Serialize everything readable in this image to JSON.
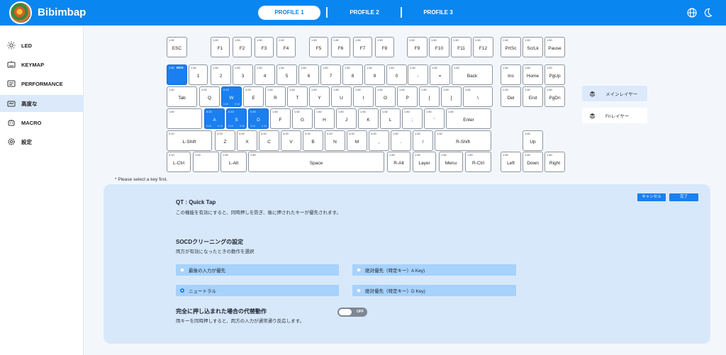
{
  "app": {
    "title": "Bibimbap"
  },
  "profiles": [
    {
      "label": "PROFILE 1",
      "active": true
    },
    {
      "label": "PROFILE 2",
      "active": false
    },
    {
      "label": "PROFILE 3",
      "active": false
    }
  ],
  "header_icons": [
    "globe-icon",
    "moon-icon"
  ],
  "sidebar": {
    "items": [
      {
        "label": "LED",
        "icon": "sun-icon"
      },
      {
        "label": "KEYMAP",
        "icon": "keyboard-icon"
      },
      {
        "label": "PERFORMANCE",
        "icon": "sliders-icon"
      },
      {
        "label": "高度な",
        "icon": "advanced-keyboard-icon",
        "active": true
      },
      {
        "label": "MACRO",
        "icon": "robot-icon"
      },
      {
        "label": "設定",
        "icon": "gear-icon"
      }
    ]
  },
  "keyboard": {
    "default_actuation": "1.60",
    "rows": [
      [
        {
          "label": "ESC",
          "act": "1.60"
        },
        {
          "label": "F1",
          "act": "1.60"
        },
        {
          "label": "F2",
          "act": "1.60"
        },
        {
          "label": "F3",
          "act": "1.60"
        },
        {
          "label": "F4",
          "act": "1.60"
        },
        {
          "label": "F5",
          "act": "1.60"
        },
        {
          "label": "F6",
          "act": "1.60"
        },
        {
          "label": "F7",
          "act": "1.60"
        },
        {
          "label": "F8",
          "act": "1.60"
        },
        {
          "label": "F9",
          "act": "1.60"
        },
        {
          "label": "F10",
          "act": "1.60"
        },
        {
          "label": "F11",
          "act": "1.60"
        },
        {
          "label": "F12",
          "act": "1.60"
        },
        {
          "label": "PrtSc",
          "act": "1.60"
        },
        {
          "label": "ScrLk",
          "act": "1.60"
        },
        {
          "label": "Pause",
          "act": "1.60"
        }
      ],
      [
        {
          "label": "",
          "act": "1.60",
          "selected": true,
          "tag": "DKS"
        },
        {
          "label": "1",
          "act": "1.60"
        },
        {
          "label": "2",
          "act": "1.60"
        },
        {
          "label": "3",
          "act": "1.60"
        },
        {
          "label": "4",
          "act": "1.60"
        },
        {
          "label": "5",
          "act": "1.60"
        },
        {
          "label": "6",
          "act": "1.60"
        },
        {
          "label": "7",
          "act": "1.60"
        },
        {
          "label": "8",
          "act": "1.60"
        },
        {
          "label": "9",
          "act": "1.60"
        },
        {
          "label": "0",
          "act": "1.60"
        },
        {
          "label": "-",
          "act": "1.60"
        },
        {
          "label": "=",
          "act": "1.60"
        },
        {
          "label": "Back",
          "act": "1.60"
        },
        {
          "label": "Ins",
          "act": "1.60"
        },
        {
          "label": "Home",
          "act": "1.60"
        },
        {
          "label": "PgUp",
          "act": "1.60"
        }
      ],
      [
        {
          "label": "Tab",
          "act": "1.60"
        },
        {
          "label": "Q",
          "act": "4.00"
        },
        {
          "label": "W",
          "act": "0.10",
          "selected": true,
          "sub": [
            "0.10",
            "0.10"
          ]
        },
        {
          "label": "E",
          "act": "4.00"
        },
        {
          "label": "R",
          "act": "1.60"
        },
        {
          "label": "T",
          "act": "1.60"
        },
        {
          "label": "Y",
          "act": "1.60"
        },
        {
          "label": "U",
          "act": "1.60"
        },
        {
          "label": "I",
          "act": "1.60"
        },
        {
          "label": "O",
          "act": "1.60"
        },
        {
          "label": "P",
          "act": "1.60"
        },
        {
          "label": "[",
          "act": "1.60"
        },
        {
          "label": "]",
          "act": "1.60"
        },
        {
          "label": "\\",
          "act": "1.60"
        },
        {
          "label": "Del",
          "act": "1.60"
        },
        {
          "label": "End",
          "act": "1.60"
        },
        {
          "label": "PgDn",
          "act": "1.60"
        }
      ],
      [
        {
          "label": "",
          "act": "1.60"
        },
        {
          "label": "A",
          "act": "0.10",
          "selected": true,
          "sub": [
            "0.10",
            "0.10"
          ]
        },
        {
          "label": "S",
          "act": "0.10",
          "selected": true,
          "sub": [
            "0.10",
            "0.10"
          ]
        },
        {
          "label": "D",
          "act": "0.10",
          "selected": true,
          "sub": [
            "0.10",
            "0.10"
          ]
        },
        {
          "label": "F",
          "act": "1.60"
        },
        {
          "label": "G",
          "act": "1.60"
        },
        {
          "label": "H",
          "act": "1.60"
        },
        {
          "label": "J",
          "act": "1.60"
        },
        {
          "label": "K",
          "act": "1.60"
        },
        {
          "label": "L",
          "act": "1.60"
        },
        {
          "label": ";",
          "act": "1.60"
        },
        {
          "label": "'",
          "act": "1.60"
        },
        {
          "label": "Enter",
          "act": "1.60"
        }
      ],
      [
        {
          "label": "L-Shift",
          "act": "0.10"
        },
        {
          "label": "Z",
          "act": "4.00"
        },
        {
          "label": "X",
          "act": "4.00"
        },
        {
          "label": "C",
          "act": "4.00"
        },
        {
          "label": "V",
          "act": "4.00"
        },
        {
          "label": "B",
          "act": "4.00"
        },
        {
          "label": "N",
          "act": "4.00"
        },
        {
          "label": "M",
          "act": "4.00"
        },
        {
          "label": ",",
          "act": "4.00"
        },
        {
          "label": ".",
          "act": "1.60"
        },
        {
          "label": "/",
          "act": "1.60"
        },
        {
          "label": "R-Shift",
          "act": "1.60"
        },
        {
          "label": "Up",
          "act": "1.60"
        }
      ],
      [
        {
          "label": "L-Ctrl",
          "act": "0.10"
        },
        {
          "label": "",
          "act": "1.60"
        },
        {
          "label": "L-Alt",
          "act": "1.60"
        },
        {
          "label": "Space",
          "act": "1.60"
        },
        {
          "label": "R-Alt",
          "act": "1.60"
        },
        {
          "label": "Layer",
          "act": "1.60"
        },
        {
          "label": "Menu",
          "act": "1.60"
        },
        {
          "label": "R-Ctrl",
          "act": "1.60"
        },
        {
          "label": "Left",
          "act": "1.60"
        },
        {
          "label": "Down",
          "act": "1.60"
        },
        {
          "label": "Right",
          "act": "1.60"
        }
      ]
    ]
  },
  "layers": {
    "main": "メインレイヤー",
    "fn": "Fnレイヤー"
  },
  "hint": "* Please select a key first.",
  "panel": {
    "cancel": "キャンセル",
    "done": "完了",
    "qt_title": "QT : Quick Tap",
    "qt_desc": "この機能を有効にすると、同時押しを防ぎ、後に押されたキーが優先されます。",
    "socd_title": "SOCDクリーニングの設定",
    "socd_desc": "両方が有効になったときの動作を選択",
    "options": [
      {
        "label": "最後の入力が優先",
        "checked": false
      },
      {
        "label": "絶対優先（特定キー）A Key)",
        "checked": false
      },
      {
        "label": "ニュートラル",
        "checked": true
      },
      {
        "label": "絶対優先（特定キー）D Key)",
        "checked": false
      }
    ],
    "alt_title": "完全に押し込まれた場合の代替動作",
    "alt_desc": "両キーを同時押しすると、両方の入力が通常通り反応します。",
    "toggle_label": "OFF",
    "toggle_on": false
  }
}
